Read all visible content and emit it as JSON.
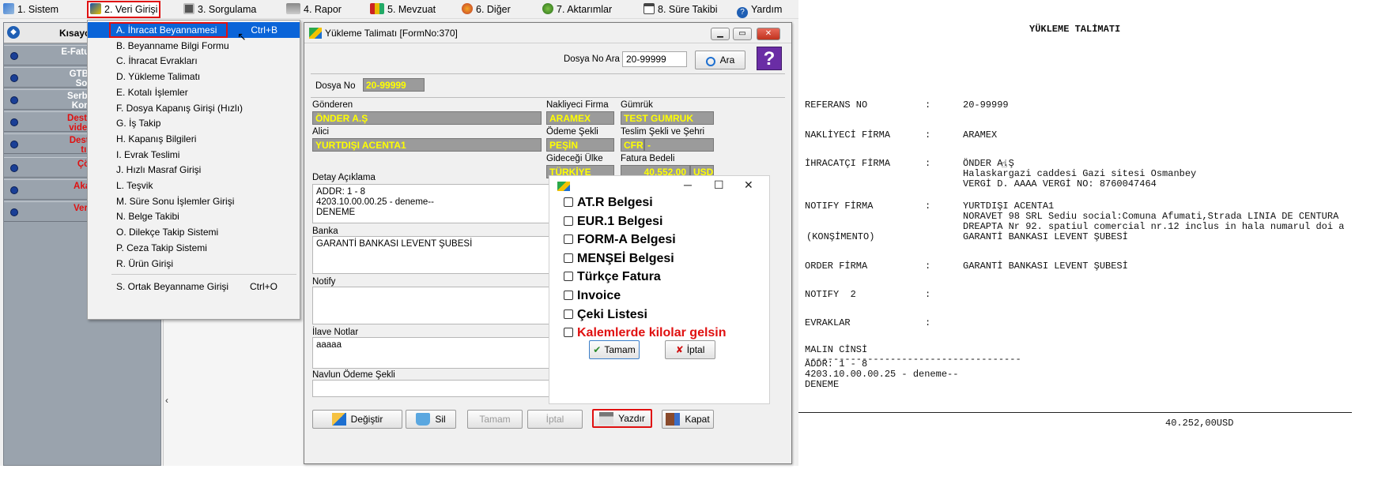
{
  "menubar": {
    "items": [
      {
        "label": "1.  Sistem",
        "icon": "system-icon"
      },
      {
        "label": "2.  Veri Girişi",
        "icon": "data-entry-icon"
      },
      {
        "label": "3.  Sorgulama",
        "icon": "query-icon"
      },
      {
        "label": "4.  Rapor",
        "icon": "printer-icon"
      },
      {
        "label": "5.  Mevzuat",
        "icon": "books-icon"
      },
      {
        "label": "6.  Diğer",
        "icon": "other-icon"
      },
      {
        "label": "7.  Aktarımlar",
        "icon": "transfer-icon"
      },
      {
        "label": "8. Süre Takibi",
        "icon": "calendar-icon"
      },
      {
        "label": "Yardım",
        "icon": "help-icon"
      }
    ]
  },
  "sidepanel": {
    "title": "Kısayol",
    "items": [
      {
        "label": "E-Fatura Refer",
        "color": "white"
      },
      {
        "label": "GTB DIR B\nSorgula",
        "color": "white"
      },
      {
        "label": "Serbest Böl\nKontrol U",
        "color": "white"
      },
      {
        "label": "Destek Port\nvideosu içi",
        "color": "red"
      },
      {
        "label": "Destek Vid\ntıklay",
        "color": "red"
      },
      {
        "label": "Çözüm",
        "color": "red"
      },
      {
        "label": "Akademi",
        "color": "red"
      },
      {
        "label": "Versiyon",
        "color": "red"
      }
    ]
  },
  "dropdown": {
    "items": [
      {
        "label": "A.  İhracat Beyannamesi",
        "shortcut": "Ctrl+B"
      },
      {
        "label": "B.  Beyanname Bilgi Formu",
        "shortcut": ""
      },
      {
        "label": "C.  İhracat Evrakları",
        "shortcut": ""
      },
      {
        "label": "D.  Yükleme Talimatı",
        "shortcut": ""
      },
      {
        "label": "E.  Kotalı İşlemler",
        "shortcut": ""
      },
      {
        "label": "F.  Dosya Kapanış Girişi (Hızlı)",
        "shortcut": ""
      },
      {
        "label": "G.  İş Takip",
        "shortcut": ""
      },
      {
        "label": "H.  Kapanış Bilgileri",
        "shortcut": ""
      },
      {
        "label": "I.   Evrak Teslimi",
        "shortcut": ""
      },
      {
        "label": "J.  Hızlı Masraf Girişi",
        "shortcut": ""
      },
      {
        "label": "L.  Teşvik",
        "shortcut": ""
      },
      {
        "label": "M.  Süre Sonu İşlemler Girişi",
        "shortcut": ""
      },
      {
        "label": "N.  Belge Takibi",
        "shortcut": ""
      },
      {
        "label": "O.  Dilekçe Takip Sistemi",
        "shortcut": ""
      },
      {
        "label": "P.  Ceza Takip Sistemi",
        "shortcut": ""
      },
      {
        "label": "R.  Ürün Girişi",
        "shortcut": ""
      },
      {
        "label": "S.  Ortak Beyanname Girişi",
        "shortcut": "Ctrl+O"
      }
    ]
  },
  "form": {
    "title": "Yükleme Talimatı [FormNo:370]",
    "dosya_no_ara_label": "Dosya No Ara",
    "dosya_no_ara_value": "20-99999",
    "ara_button": "Ara",
    "dosya_no_label": "Dosya No",
    "dosya_no_value": "20-99999",
    "gonderen_label": "Gönderen",
    "gonderen_value": "ÖNDER A.Ş",
    "nakliyeci_label": "Nakliyeci Firma",
    "nakliyeci_value": "ARAMEX",
    "gumruk_label": "Gümrük",
    "gumruk_value": "TEST GUMRUK",
    "alici_label": "Alici",
    "alici_value": "YURTDIŞI ACENTA1",
    "odeme_label": "Ödeme Şekli",
    "odeme_value": "PEŞİN",
    "teslim_label": "Teslim Şekli ve Şehri",
    "teslim_value": "CFR",
    "teslim_city": "-",
    "gidecegi_label": "Gideceği Ülke",
    "gidecegi_value": "TÜRKİYE",
    "fatura_label": "Fatura Bedeli",
    "fatura_value": "40.552,00",
    "fatura_currency": "USD",
    "detay_label": "Detay Açıklama",
    "detay_value": "ADDR: 1 - 8\n4203.10.00.00.25 - deneme--\nDENEME",
    "banka_label": "Banka",
    "banka_value": "GARANTİ BANKASI LEVENT ŞUBESİ",
    "notify_label": "Notify",
    "notify_value": "",
    "ilave_label": "İlave Notlar",
    "ilave_value": "aaaaa",
    "navlun_label": "Navlun Ödeme Şekli",
    "navlun_value": "",
    "buttons": {
      "degistir": "Değiştir",
      "sil": "Sil",
      "tamam": "Tamam",
      "iptal": "İptal",
      "yazdir": "Yazdır",
      "kapat": "Kapat"
    }
  },
  "dialog": {
    "checks": [
      {
        "label": "AT.R Belgesi",
        "checked": false,
        "red": false
      },
      {
        "label": "EUR.1 Belgesi",
        "checked": false,
        "red": false
      },
      {
        "label": "FORM-A Belgesi",
        "checked": false,
        "red": false
      },
      {
        "label": "MENŞEİ Belgesi",
        "checked": false,
        "red": false
      },
      {
        "label": "Türkçe Fatura",
        "checked": false,
        "red": false
      },
      {
        "label": "Invoice",
        "checked": false,
        "red": false
      },
      {
        "label": "Çeki Listesi",
        "checked": false,
        "red": false
      },
      {
        "label": "Kalemlerde kilolar gelsin",
        "checked": false,
        "red": true
      }
    ],
    "ok_button": "Tamam",
    "cancel_button": "İptal"
  },
  "preview": {
    "title": "YÜKLEME TALİMATI",
    "referans_label": "REFERANS NO",
    "referans_value": "20-99999",
    "nakliyeci_label": "NAKLİYECİ FİRMA",
    "nakliyeci_value": "ARAMEX",
    "ihracatci_label": "İHRACATÇI FİRMA",
    "ihracatci_lines": [
      "ÖNDER A.Ş",
      "Halaskargazi caddesi Gazi sitesi Osmanbey",
      "VERGİ D. AAAA VERGİ NO: 8760047464"
    ],
    "notify_label": "NOTIFY FİRMA",
    "konsimento_label": "(KONŞİMENTO)",
    "notify_lines": [
      "YURTDIŞI ACENTA1",
      "NORAVET 98 SRL Sediu social:Comuna Afumati,Strada LINIA DE CENTURA",
      "DREAPTA Nr 92. spatiul comercial nr.12 inclus in hala numarul doi a",
      "GARANTİ BANKASI LEVENT ŞUBESİ"
    ],
    "order_label": "ORDER FİRMA",
    "order_value": "GARANTİ BANKASI LEVENT ŞUBESİ",
    "notify2_label": "NOTIFY  2",
    "evraklar_label": "EVRAKLAR",
    "malin_label": "MALIN CİNSİ",
    "malin_rule": "--------------------------------------",
    "malin_lines": [
      "ADDR: 1 - 8",
      "4203.10.00.00.25 - deneme--",
      "DENEME"
    ],
    "colon": ":",
    "total": "40.252,00USD"
  }
}
